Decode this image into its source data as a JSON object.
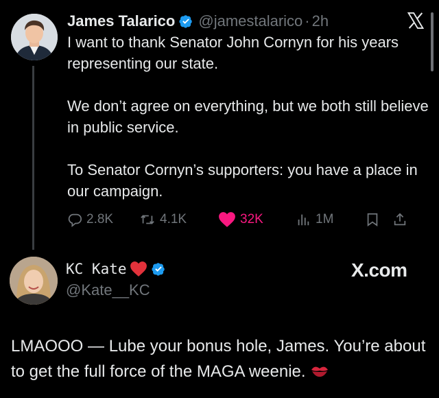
{
  "tweet": {
    "author_name": "James Talarico",
    "handle": "@jamestalarico",
    "separator": "·",
    "time": "2h",
    "paragraphs": [
      "I want to thank Senator John Cornyn for his years representing our state.",
      "We don’t agree on everything, but we both still believe in public service.",
      "To Senator Cornyn’s supporters: you have a place in our campaign."
    ],
    "stats": {
      "replies": "2.8K",
      "reposts": "4.1K",
      "likes": "32K",
      "views": "1M"
    }
  },
  "reply": {
    "author_name": "KC Kate",
    "handle": "@Kate__KC",
    "watermark": "X.com",
    "text": "LMAOOO — Lube your bonus hole, James. You’re about to get the full force of the MAGA weenie."
  },
  "colors": {
    "background": "#000000",
    "text": "#e7e9ea",
    "secondary": "#71767b",
    "verified": "#1d9bf0",
    "like": "#f91880"
  },
  "icons": [
    "verified-icon",
    "x-logo-icon",
    "reply-icon",
    "repost-icon",
    "like-icon",
    "views-icon",
    "bookmark-icon",
    "share-icon",
    "heart-emoji-icon",
    "kiss-emoji-icon"
  ]
}
